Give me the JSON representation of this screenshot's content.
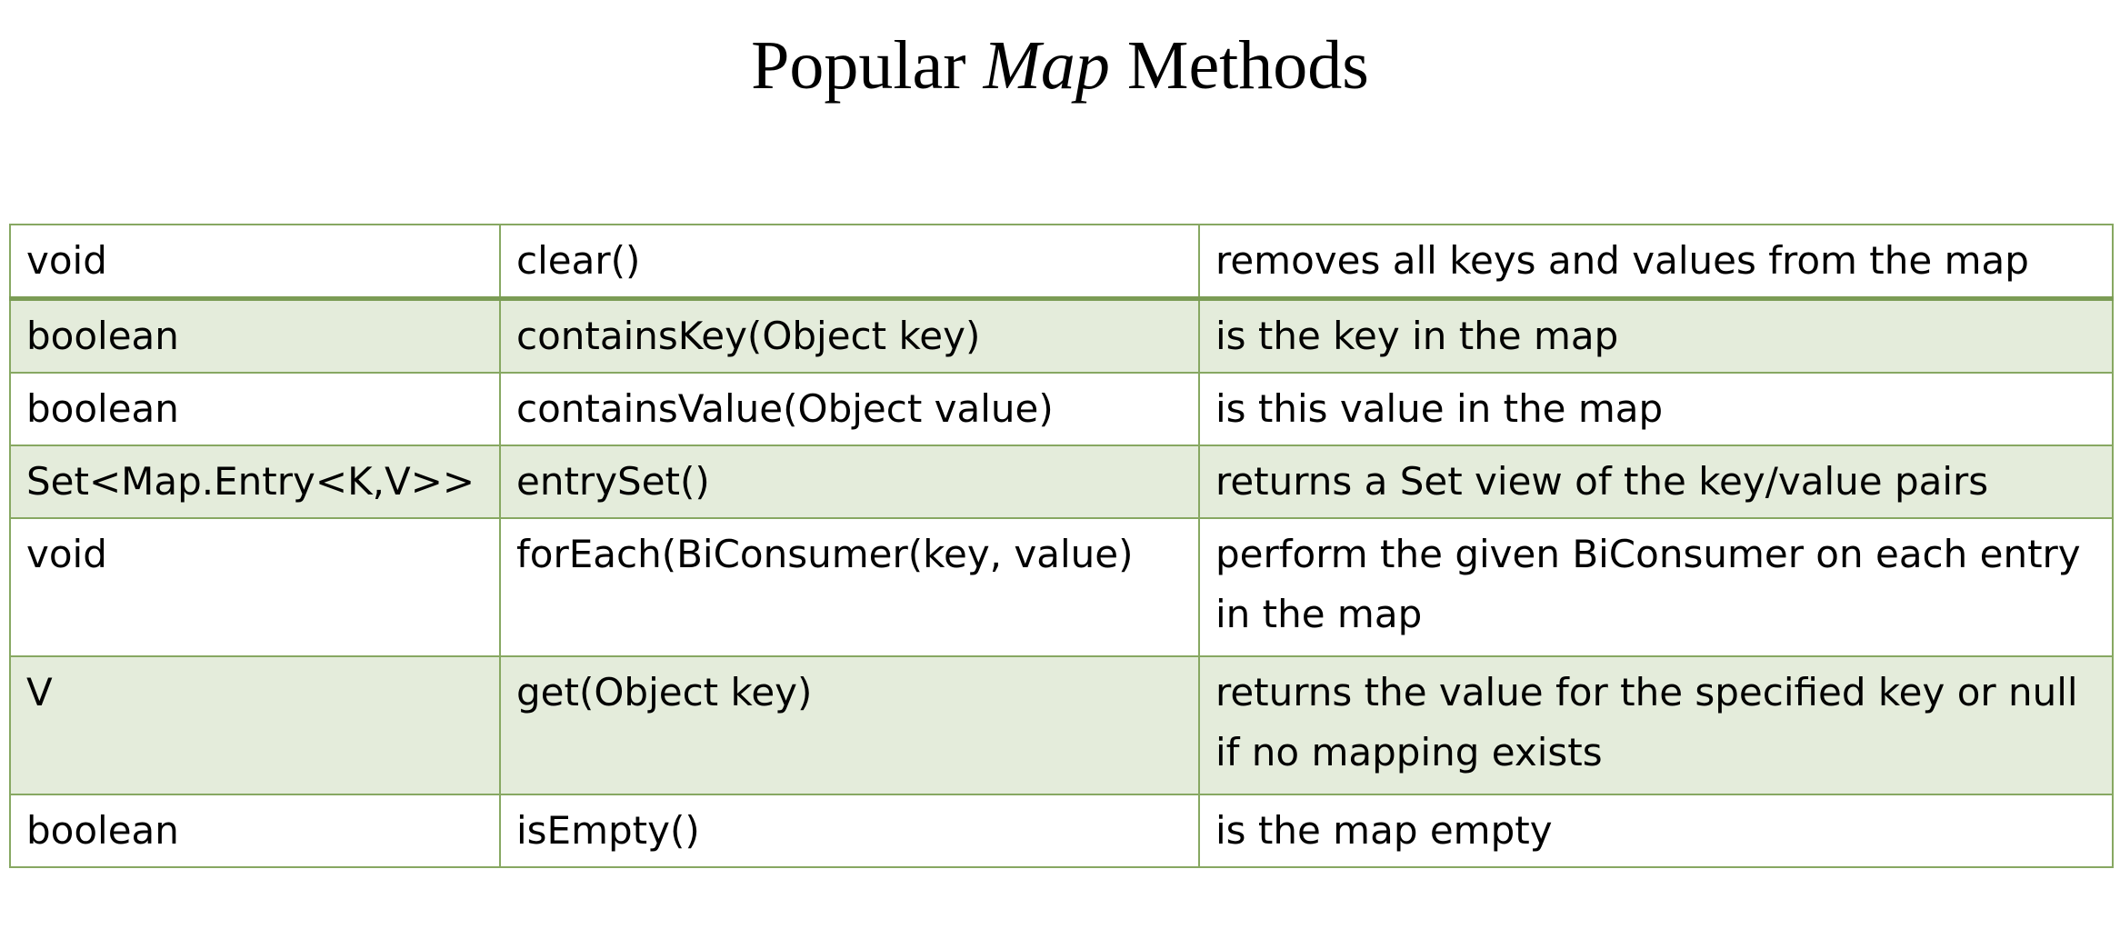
{
  "title": {
    "before": "Popular ",
    "emphasis": "Map",
    "after": " Methods"
  },
  "rows": [
    {
      "type": "void",
      "method": "clear()",
      "description": "removes all keys and values from the map"
    },
    {
      "type": "boolean",
      "method": "containsKey(Object key)",
      "description": "is the key in the map"
    },
    {
      "type": "boolean",
      "method": "containsValue(Object value)",
      "description": "is this value in the map"
    },
    {
      "type": "Set<Map.Entry<K,V>>",
      "method": "entrySet()",
      "description": "returns a Set view of the key/value pairs"
    },
    {
      "type": "void",
      "method": "forEach(BiConsumer(key, value)",
      "description": "perform the given BiConsumer on each entry in the map"
    },
    {
      "type": "V",
      "method": "get(Object key)",
      "description": "returns the value for the specified key or null if no mapping exists"
    },
    {
      "type": "boolean",
      "method": "isEmpty()",
      "description": "is the map empty"
    }
  ],
  "colors": {
    "border": "#87a862",
    "shaded_row": "#e4ecdb",
    "text": "#000000"
  }
}
